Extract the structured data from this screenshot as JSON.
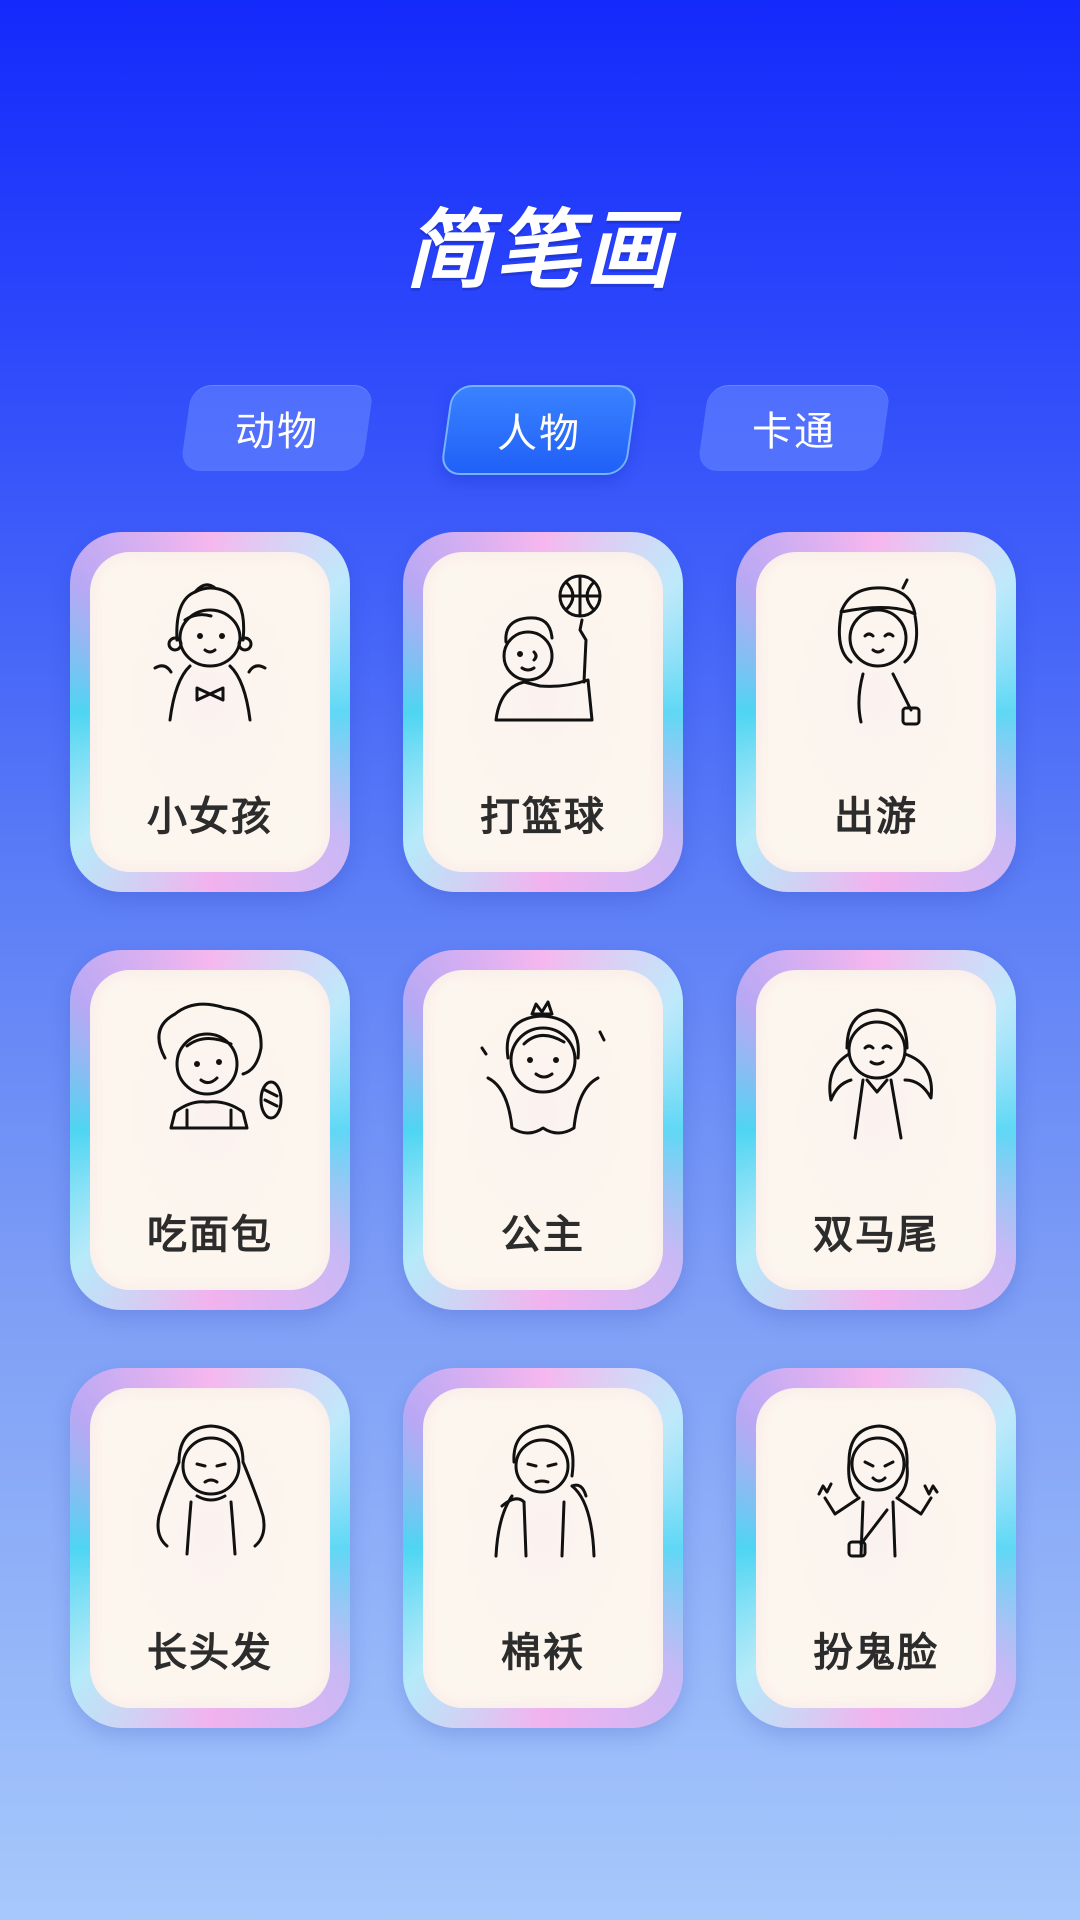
{
  "page": {
    "title": "简笔画"
  },
  "tabs": [
    {
      "label": "动物",
      "active": false
    },
    {
      "label": "人物",
      "active": true
    },
    {
      "label": "卡通",
      "active": false
    }
  ],
  "cards": [
    {
      "label": "小女孩",
      "icon": "little-girl-drawing-icon"
    },
    {
      "label": "打篮球",
      "icon": "basketball-boy-drawing-icon"
    },
    {
      "label": "出游",
      "icon": "outing-girl-drawing-icon"
    },
    {
      "label": "吃面包",
      "icon": "eating-bread-drawing-icon"
    },
    {
      "label": "公主",
      "icon": "princess-drawing-icon"
    },
    {
      "label": "双马尾",
      "icon": "twin-tails-drawing-icon"
    },
    {
      "label": "长头发",
      "icon": "long-hair-drawing-icon"
    },
    {
      "label": "棉袄",
      "icon": "cotton-jacket-drawing-icon"
    },
    {
      "label": "扮鬼脸",
      "icon": "funny-face-drawing-icon"
    }
  ],
  "colors": {
    "background_top": "#1429fb",
    "background_bottom": "#a6c8fb",
    "tab_active": "#2060f8",
    "card_inner": "#fdf8ef",
    "label_text": "#2c2c2c"
  }
}
